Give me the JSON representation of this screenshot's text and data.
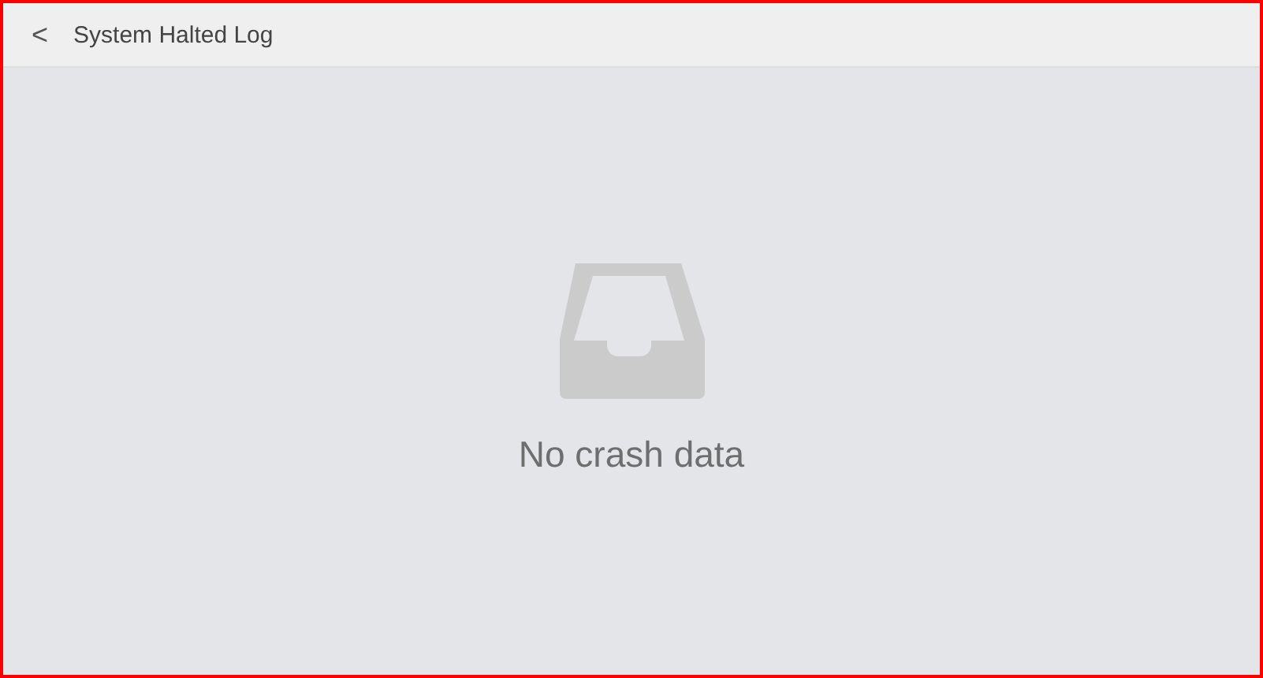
{
  "header": {
    "back": "<",
    "title": "System Halted Log"
  },
  "empty_state": {
    "message": "No crash data"
  }
}
